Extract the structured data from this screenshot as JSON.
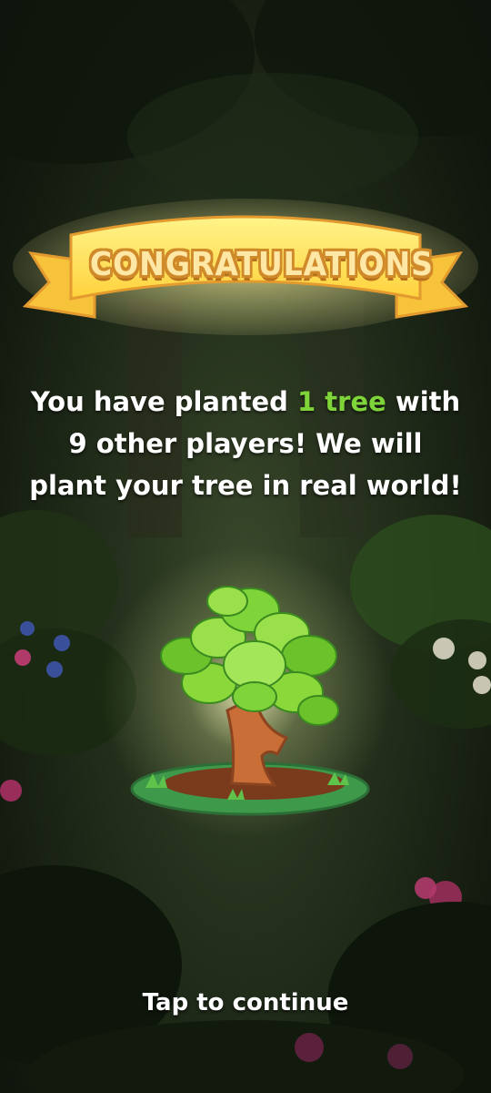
{
  "banner": {
    "title": "CONGRATULATIONS"
  },
  "message": {
    "part1": "You have planted ",
    "highlight": "1 tree",
    "part2": " with",
    "line2": "9 other players! We will",
    "line3": "plant your tree in real world!"
  },
  "footer": {
    "tap_label": "Tap to continue"
  },
  "colors": {
    "highlight": "#7fd43a",
    "banner_fill": "#ffe35a",
    "banner_outline": "#e39a2e"
  },
  "icons": {
    "tree": "tree-icon"
  }
}
